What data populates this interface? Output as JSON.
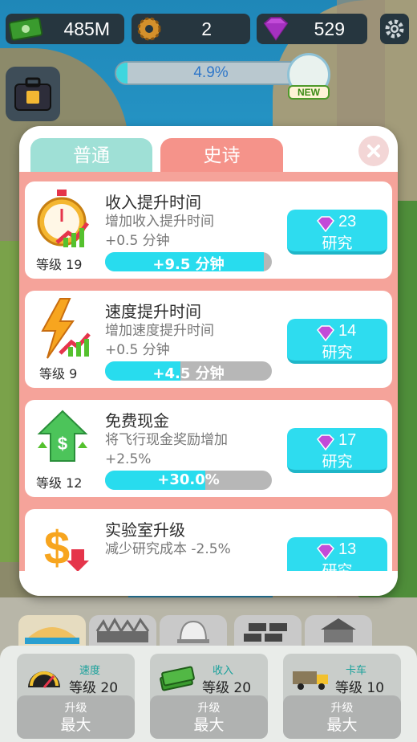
{
  "hud": {
    "cash": "485M",
    "gears": "2",
    "gems": "529",
    "icons": [
      "cash-icon",
      "gear-icon",
      "gem-icon",
      "settings-icon"
    ]
  },
  "progress": {
    "text": "4.9%",
    "value": 0.049,
    "new_badge": "NEW"
  },
  "tabs": {
    "normal": "普通",
    "epic": "史诗",
    "active": "epic"
  },
  "cards": [
    {
      "title": "收入提升时间",
      "desc_line1": "增加收入提升时间",
      "desc_line2": "+0.5 分钟",
      "level": "等级 19",
      "bar_text": "+9.5 分钟",
      "bar_fill": 0.95,
      "cost": "23",
      "button": "研究",
      "icon": "stopwatch-icon"
    },
    {
      "title": "速度提升时间",
      "desc_line1": "增加速度提升时间",
      "desc_line2": "+0.5 分钟",
      "level": "等级 9",
      "bar_text": "+4.5 分钟",
      "bar_fill": 0.45,
      "cost": "14",
      "button": "研究",
      "icon": "lightning-icon"
    },
    {
      "title": "免费现金",
      "desc_line1": "将飞行现金奖励增加",
      "desc_line2": "+2.5%",
      "level": "等级 12",
      "bar_text": "+30.0%",
      "bar_fill": 0.6,
      "cost": "17",
      "button": "研究",
      "icon": "cash-up-icon"
    },
    {
      "title": "实验室升级",
      "desc_line1": "减少研究成本 -2.5%",
      "desc_line2": "",
      "level": "",
      "bar_text": "",
      "bar_fill": 0,
      "cost": "13",
      "button": "研究",
      "icon": "dollar-down-icon"
    }
  ],
  "bottom": {
    "upgrades": [
      {
        "name": "速度",
        "level": "等级 20",
        "button_label": "升级",
        "button_value": "最大",
        "icon": "speedometer-icon"
      },
      {
        "name": "收入",
        "level": "等级 20",
        "button_label": "升级",
        "button_value": "最大",
        "icon": "cash-stack-icon"
      },
      {
        "name": "卡车",
        "level": "等级 10",
        "button_label": "升级",
        "button_value": "最大",
        "icon": "truck-icon"
      }
    ],
    "category_icons": [
      "beach-icon",
      "grass-icon",
      "helmet-icon",
      "bricks-icon",
      "house-icon"
    ]
  },
  "colors": {
    "accent": "#28dcee",
    "epic_tab": "#f5938a",
    "normal_tab": "#9fe0d6",
    "hud_bg": "#26363f",
    "gem": "#c24bd8"
  }
}
